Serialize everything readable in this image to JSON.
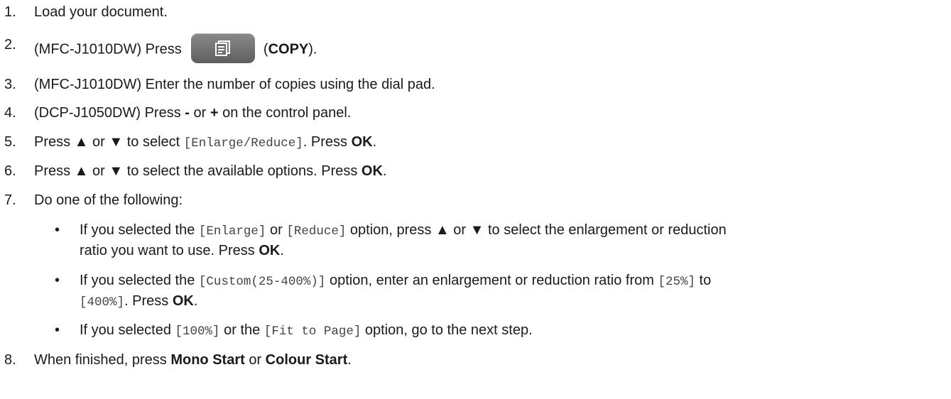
{
  "steps": [
    {
      "n": "1.",
      "parts": [
        {
          "t": "Load your document."
        }
      ]
    },
    {
      "n": "2.",
      "parts": [
        {
          "t": "(MFC-J1010DW) Press "
        },
        {
          "icon": "copy-icon"
        },
        {
          "t": " ("
        },
        {
          "b": "COPY"
        },
        {
          "t": ")."
        }
      ]
    },
    {
      "n": "3.",
      "parts": [
        {
          "t": "(MFC-J1010DW) Enter the number of copies using the dial pad."
        }
      ]
    },
    {
      "n": "4.",
      "parts": [
        {
          "t": "(DCP-J1050DW) Press "
        },
        {
          "b": "-"
        },
        {
          "t": " or "
        },
        {
          "b": "+"
        },
        {
          "t": " on the control panel."
        }
      ]
    },
    {
      "n": "5.",
      "parts": [
        {
          "t": "Press ▲ or ▼ to select "
        },
        {
          "m": "[Enlarge/Reduce]"
        },
        {
          "t": ". Press "
        },
        {
          "b": "OK"
        },
        {
          "t": "."
        }
      ]
    },
    {
      "n": "6.",
      "parts": [
        {
          "t": "Press ▲ or ▼ to select the available options. Press "
        },
        {
          "b": "OK"
        },
        {
          "t": "."
        }
      ]
    },
    {
      "n": "7.",
      "parts": [
        {
          "t": "Do one of the following:"
        }
      ]
    },
    {
      "n": "8.",
      "parts": [
        {
          "t": "When finished, press "
        },
        {
          "b": "Mono Start"
        },
        {
          "t": " or "
        },
        {
          "b": "Colour Start"
        },
        {
          "t": "."
        }
      ]
    }
  ],
  "bullets": [
    {
      "lines": [
        [
          {
            "t": "If you selected the "
          },
          {
            "m": "[Enlarge]"
          },
          {
            "t": " or "
          },
          {
            "m": "[Reduce]"
          },
          {
            "t": " option, press ▲ or ▼ to select the enlargement or reduction"
          }
        ],
        [
          {
            "t": "ratio you want to use. Press "
          },
          {
            "b": "OK"
          },
          {
            "t": "."
          }
        ]
      ]
    },
    {
      "lines": [
        [
          {
            "t": "If you selected the "
          },
          {
            "m": "[Custom(25-400%)]"
          },
          {
            "t": " option, enter an enlargement or reduction ratio from "
          },
          {
            "m": "[25%]"
          },
          {
            "t": " to"
          }
        ],
        [
          {
            "m": "[400%]"
          },
          {
            "t": ". Press "
          },
          {
            "b": "OK"
          },
          {
            "t": "."
          }
        ]
      ]
    },
    {
      "lines": [
        [
          {
            "t": "If you selected "
          },
          {
            "m": "[100%]"
          },
          {
            "t": " or the "
          },
          {
            "m": "[Fit to Page]"
          },
          {
            "t": " option, go to the next step."
          }
        ]
      ]
    }
  ],
  "bullet_char": "•"
}
